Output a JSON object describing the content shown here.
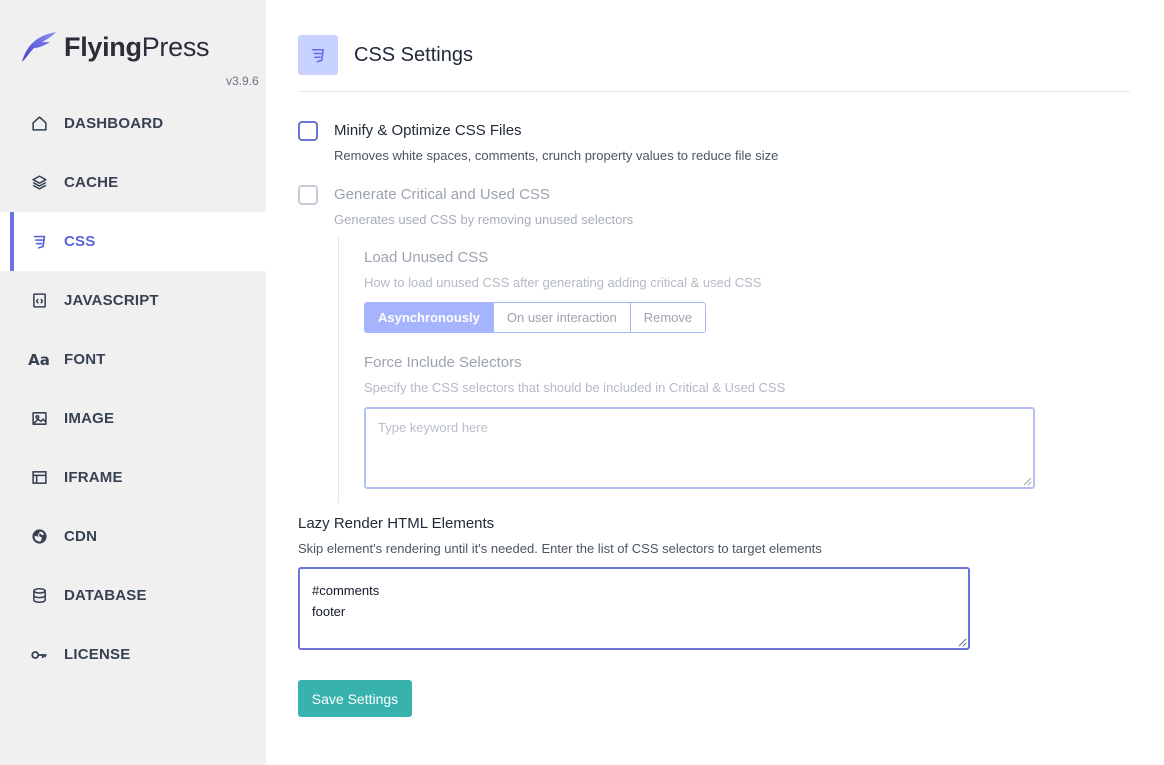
{
  "brand": {
    "name_bold": "Flying",
    "name_regular": "Press",
    "version": "v3.9.6",
    "accent": "#5b64d8"
  },
  "sidebar": {
    "items": [
      {
        "label": "DASHBOARD",
        "icon": "home-icon"
      },
      {
        "label": "CACHE",
        "icon": "layers-icon"
      },
      {
        "label": "CSS",
        "icon": "css3-icon",
        "active": true
      },
      {
        "label": "JAVASCRIPT",
        "icon": "code-file-icon"
      },
      {
        "label": "FONT",
        "icon": "font-icon"
      },
      {
        "label": "IMAGE",
        "icon": "image-icon"
      },
      {
        "label": "IFRAME",
        "icon": "window-icon"
      },
      {
        "label": "CDN",
        "icon": "globe-icon"
      },
      {
        "label": "DATABASE",
        "icon": "database-icon"
      },
      {
        "label": "LICENSE",
        "icon": "key-icon"
      }
    ]
  },
  "header": {
    "title": "CSS Settings",
    "icon": "css3-icon"
  },
  "options": {
    "minify": {
      "title": "Minify & Optimize CSS Files",
      "desc": "Removes white spaces, comments, crunch property values to reduce file size",
      "checked": false
    },
    "critical": {
      "title": "Generate Critical and Used CSS",
      "desc": "Generates used CSS by removing unused selectors",
      "checked": false,
      "disabled": true
    }
  },
  "unused": {
    "title": "Load Unused CSS",
    "desc": "How to load unused CSS after generating adding critical & used CSS",
    "options": [
      "Asynchronously",
      "On user interaction",
      "Remove"
    ],
    "selected": "Asynchronously"
  },
  "force_include": {
    "title": "Force Include Selectors",
    "desc": "Specify the CSS selectors that should be included in Critical & Used CSS",
    "placeholder": "Type keyword here",
    "value": ""
  },
  "lazy_render": {
    "title": "Lazy Render HTML Elements",
    "desc": "Skip element's rendering until it's needed. Enter the list of CSS selectors to target elements",
    "lines": [
      "#comments",
      "footer"
    ]
  },
  "save_label": "Save Settings",
  "colors": {
    "save": "#38b2ac",
    "active": "#5b64d8",
    "segment_selected": "#a5b4fc"
  }
}
